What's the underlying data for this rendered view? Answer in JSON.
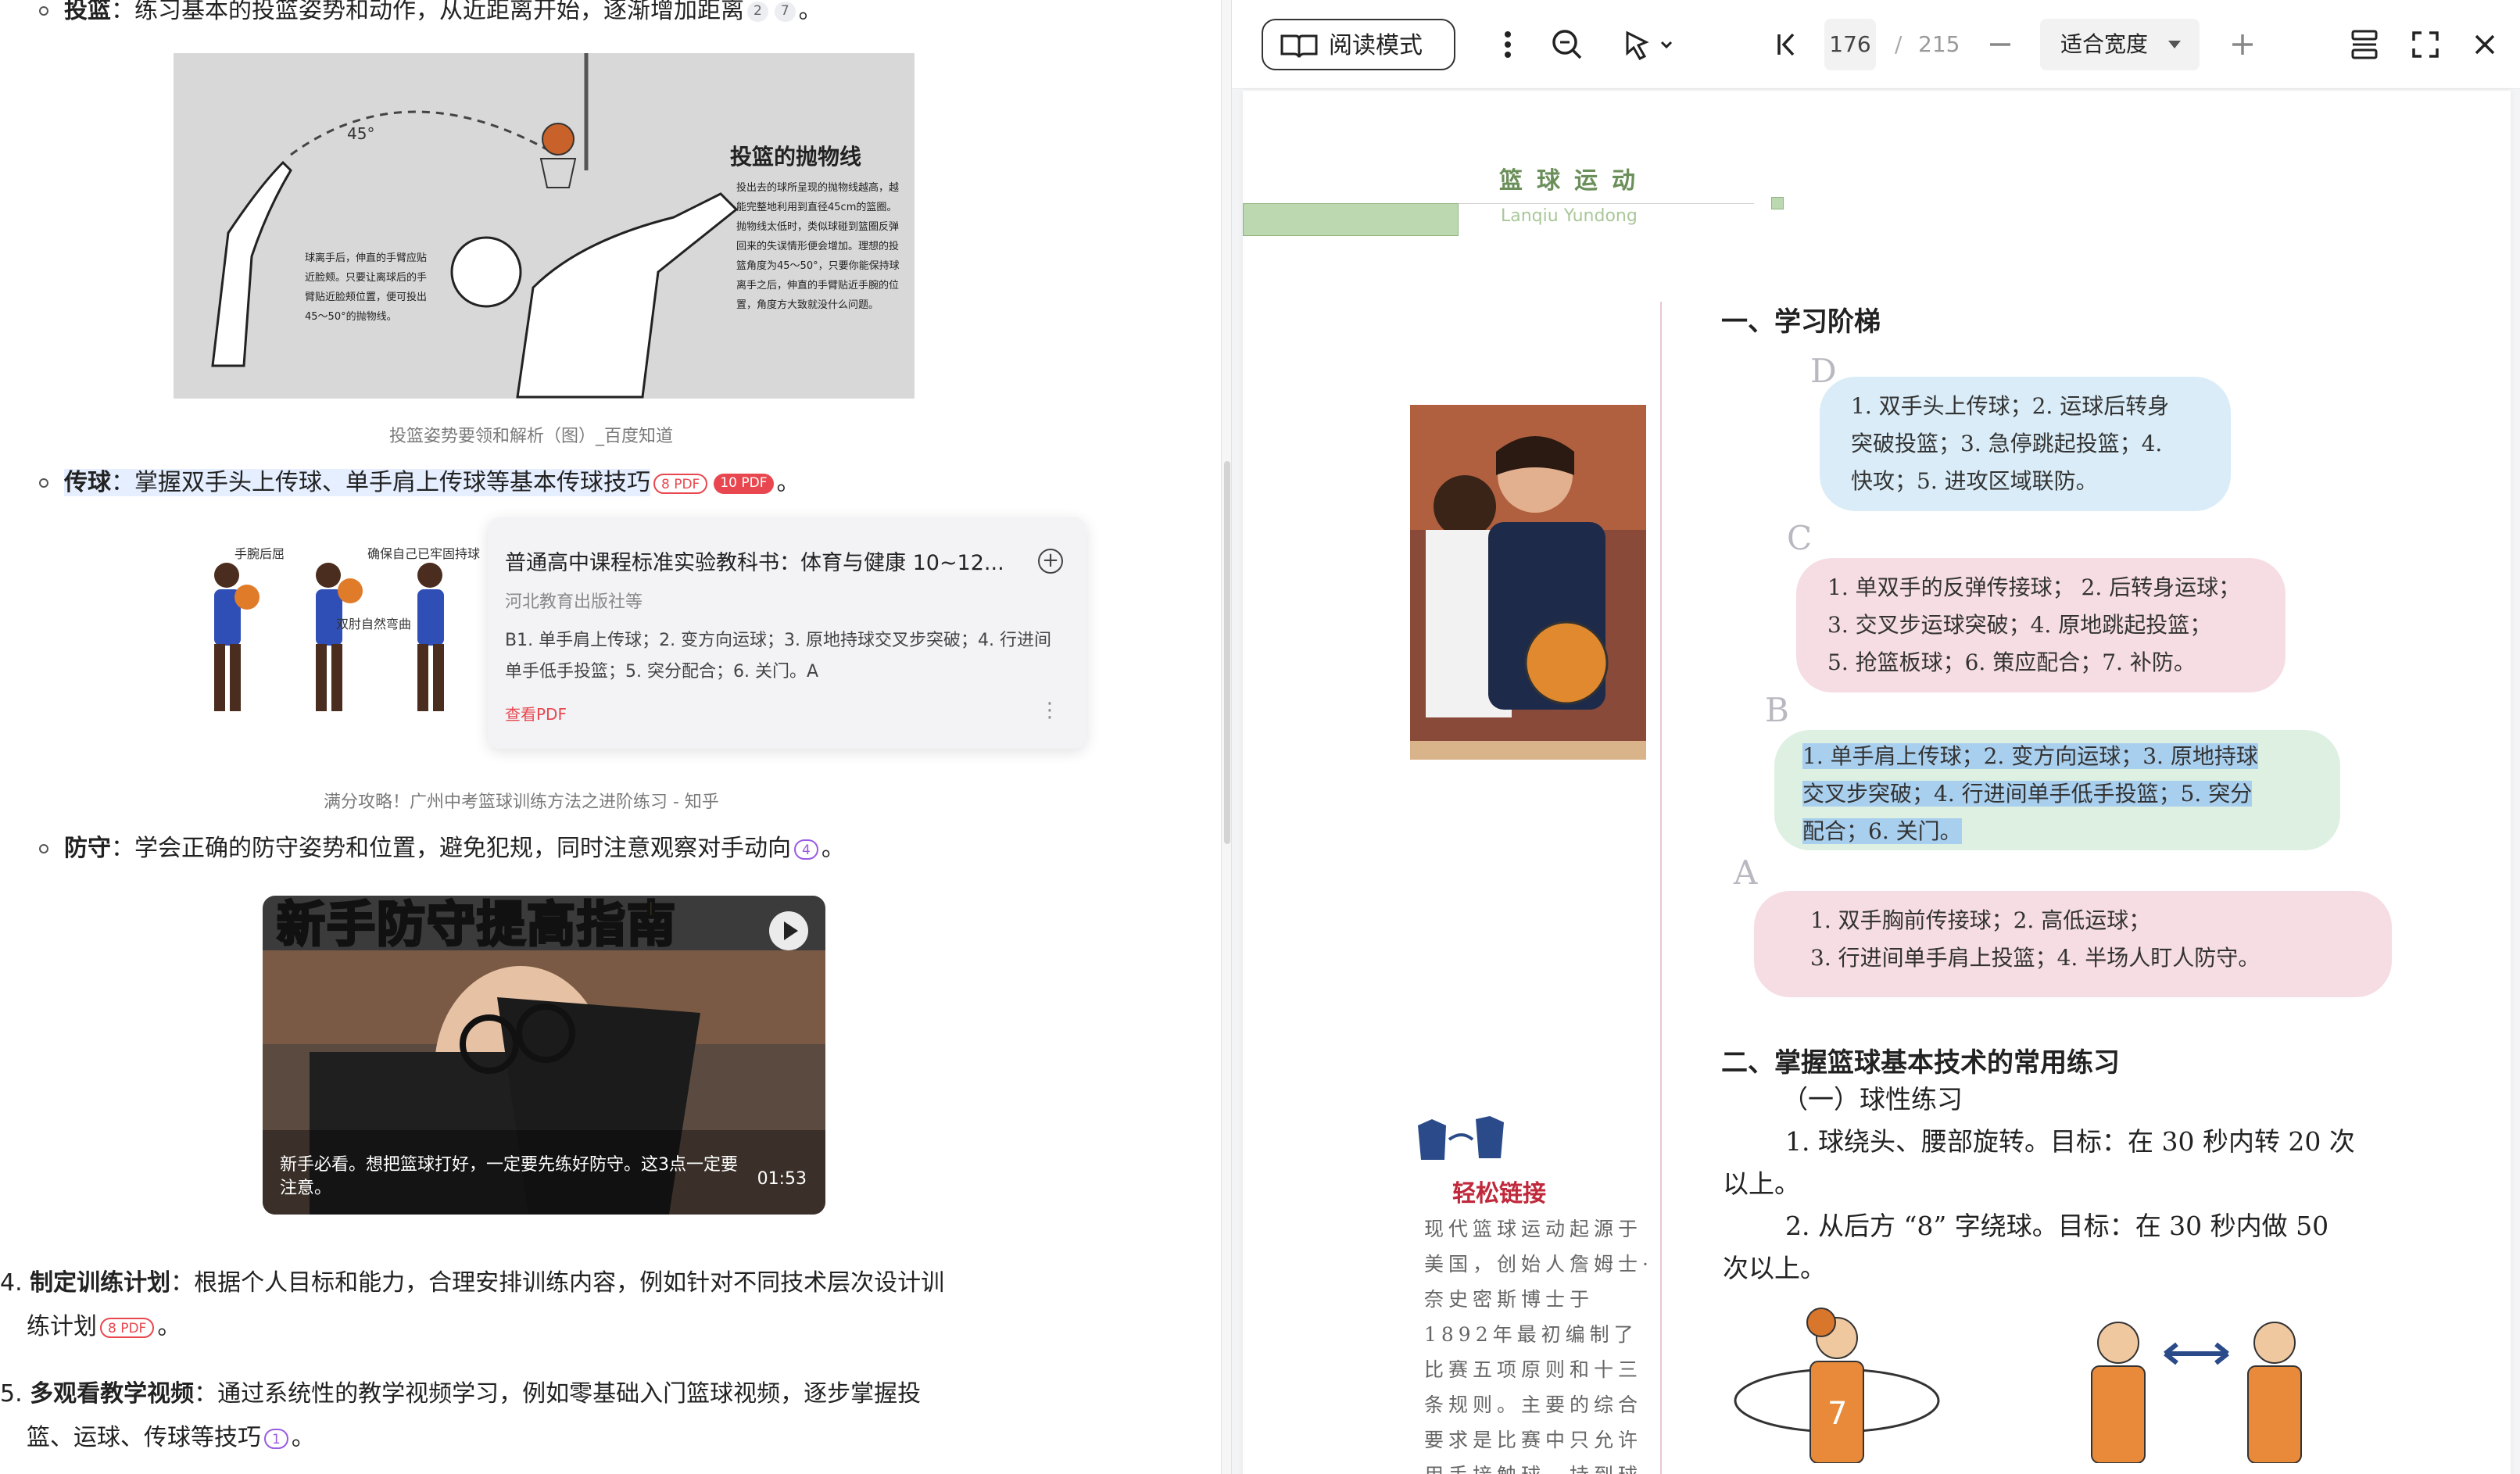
{
  "left": {
    "shooting": {
      "term": "投篮",
      "text": "：练习基本的投篮姿势和动作，从近距离开始，逐渐增加距离",
      "refs": [
        "2",
        "7"
      ],
      "end": "。",
      "figure_title": "投篮的抛物线",
      "figure_angle": "45°",
      "figure_note_1": "投出去的球所呈现的抛物线越高，越能完整地利用到直径45cm的篮圈。抛物线太低时，类似球碰到篮圈反弹回来的失误情形便会增加。理想的投篮角度为45～50°，只要你能保持球离手之后，伸直的手臂贴近手腕的位置，角度方大致就没什么问题。",
      "figure_note_2": "球离手后，伸直的手臂应贴近脸颊。只要让离球后的手臂贴近脸颊位置，便可投出45～50°的抛物线。",
      "caption": "投篮姿势要领和解析（图）_百度知道"
    },
    "passing": {
      "term": "传球",
      "text": "：掌握双手头上传球、单手肩上传球等基本传球技巧",
      "ref1": "8 PDF",
      "ref2": "10 PDF",
      "end": "。",
      "figure_labels": [
        "手腕后屈",
        "确保自己已牢固持球",
        "双肘自然弯曲"
      ],
      "caption": "满分攻略！广州中考篮球训练方法之进阶练习 - 知乎"
    },
    "popup": {
      "title": "普通高中课程标准实验教科书：体育与健康 10~12...",
      "publisher": "河北教育出版社等",
      "body": "B1. 单手肩上传球；2. 变方向运球；3. 原地持球交叉步突破；4. 行进间单手低手投篮；5. 突分配合；6. 关门。A",
      "link": "查看PDF"
    },
    "defense": {
      "term": "防守",
      "text": "：学会正确的防守姿势和位置，避免犯规，同时注意观察对手动向",
      "ref": "4",
      "end": "。"
    },
    "video": {
      "title": "新手防守提高指南",
      "desc": "新手必看。想把篮球打好，一定要先练好防守。这3点一定要注意。",
      "duration": "01:53"
    },
    "item4": {
      "num": "4.",
      "term": "制定训练计划",
      "text1": "：根据个人目标和能力，合理安排训练内容，例如针对不同技术层次设计训",
      "text2": "练计划",
      "ref": "8 PDF",
      "end": "。"
    },
    "item5": {
      "num": "5.",
      "term": "多观看教学视频",
      "text1": "：通过系统性的教学视频学习，例如零基础入门篮球视频，逐步掌握投",
      "text2": "篮、运球、传球等技巧",
      "ref": "1",
      "end": "。"
    }
  },
  "toolbar": {
    "read_mode": "阅读模式",
    "page_current": "176",
    "page_sep": "/",
    "page_total": "215",
    "zoom": "适合宽度"
  },
  "pdf": {
    "header_cn": "篮球运动",
    "header_en": "Lanqiu Yundong",
    "section1": "一、学习阶梯",
    "levels": [
      {
        "level": "D",
        "lines": [
          "1. 双手头上传球；2. 运球后转身",
          "突破投篮；3. 急停跳起投篮；4.",
          "快攻；5. 进攻区域联防。"
        ]
      },
      {
        "level": "C",
        "lines": [
          "1. 单双手的反弹传接球；  2. 后转身运球；",
          "3. 交叉步运球突破；4. 原地跳起投篮；",
          "5. 抢篮板球；6. 策应配合；7. 补防。"
        ]
      },
      {
        "level": "B",
        "lines": [
          "1. 单手肩上传球；2. 变方向运球；3. 原地持球",
          "交叉步突破；4. 行进间单手低手投篮；5. 突分",
          "配合；6. 关门。"
        ]
      },
      {
        "level": "A",
        "lines": [
          "1. 双手胸前传接球；2. 高低运球；",
          "3. 行进间单手肩上投篮；4. 半场人盯人防守。"
        ]
      }
    ],
    "section2": "二、掌握篮球基本技术的常用练习",
    "sub1": "（一）球性练习",
    "ex1a": "1. 球绕头、腰部旋转。目标：在 30 秒内转 20 次",
    "ex1b": "以上。",
    "ex2a": "2. 从后方 “8” 字绕球。目标：在 30 秒内做 50",
    "ex2b": "次以上。",
    "side_title": "轻松链接",
    "side_text": "现代篮球运动起源于美国，创始人詹姆士·奈史密斯博士于1892年最初编制了比赛五项原则和十三条规则。主要的综合要求是比赛中只允许用手接触球，持到球后可以用单"
  }
}
